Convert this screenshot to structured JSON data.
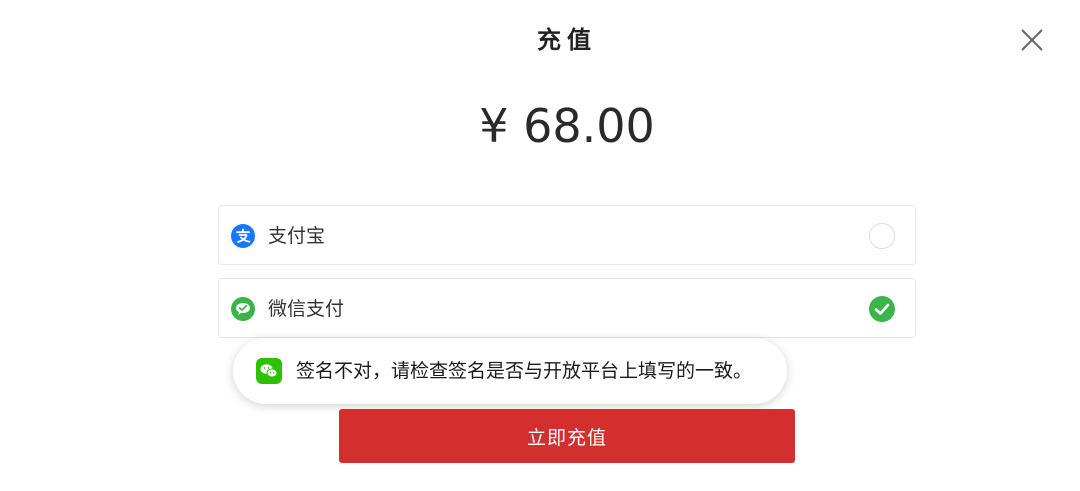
{
  "header": {
    "title": "充值",
    "close_icon": "close-icon"
  },
  "amount": {
    "text": "¥ 68.00"
  },
  "payment_methods": [
    {
      "label": "支付宝",
      "icon": "alipay-icon",
      "selected": false,
      "color": "#1677ff"
    },
    {
      "label": "微信支付",
      "icon": "wechat-pay-icon",
      "selected": true,
      "color": "#3bb54a"
    }
  ],
  "toast": {
    "icon": "wechat-icon",
    "message": "签名不对，请检查签名是否与开放平台上填写的一致。",
    "icon_color": "#2dc100"
  },
  "submit": {
    "label": "立即充值",
    "color": "#d32f2f"
  }
}
